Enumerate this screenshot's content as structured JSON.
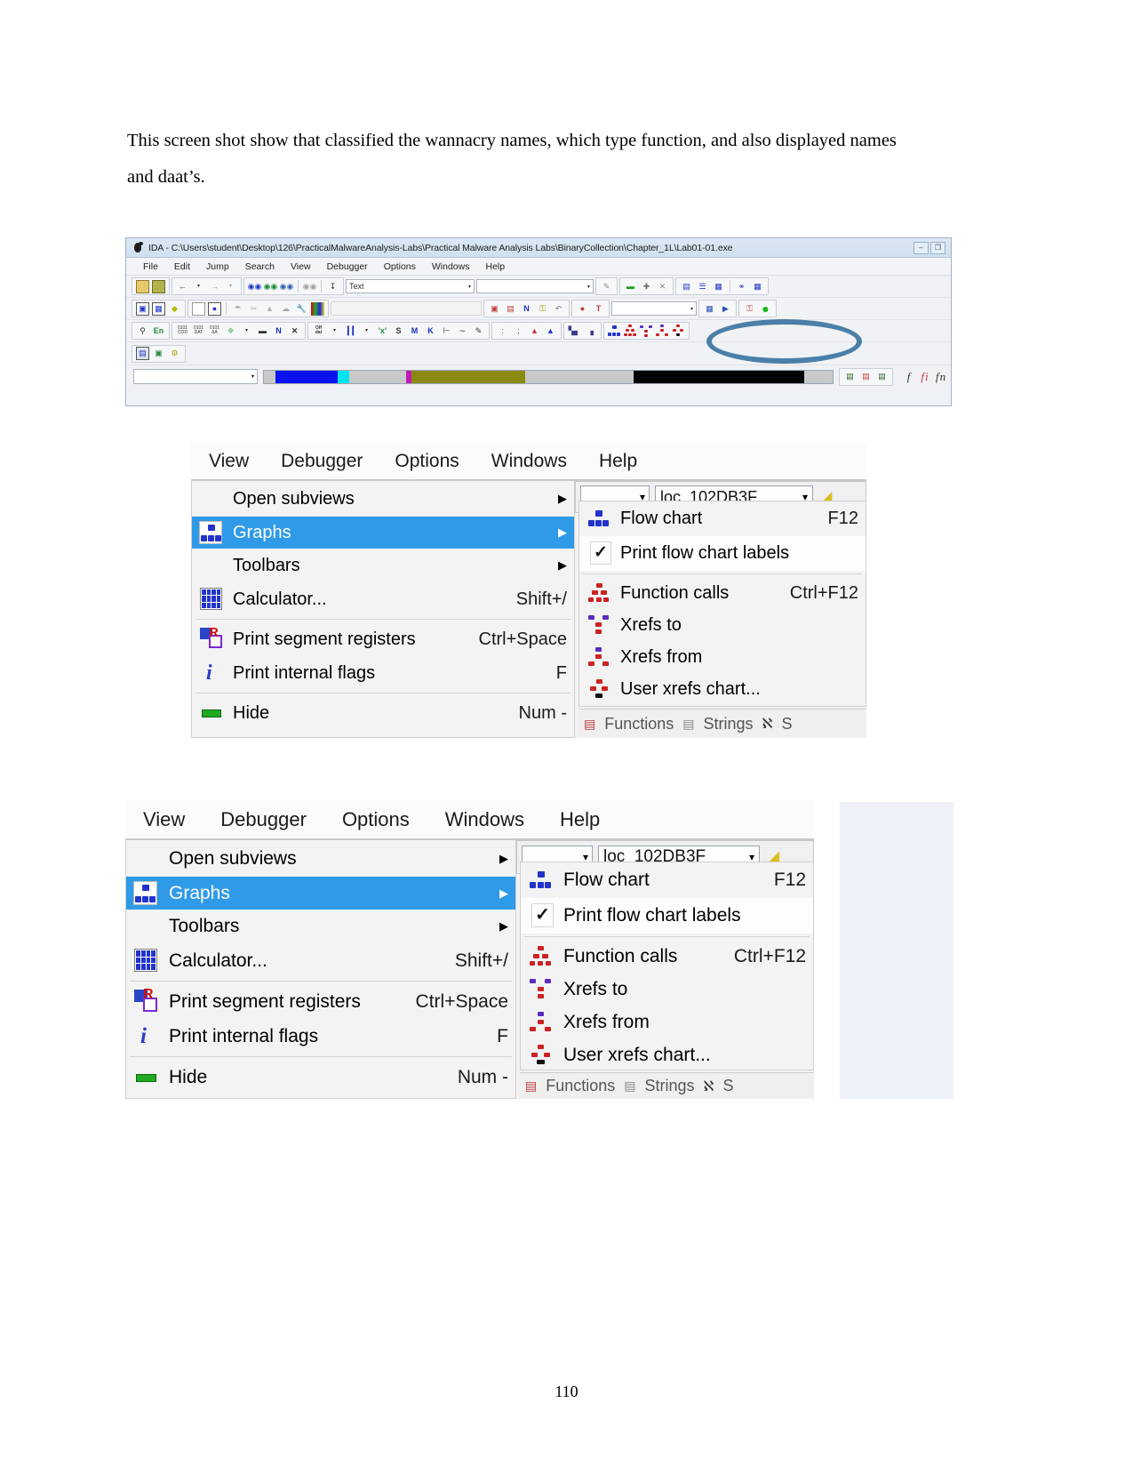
{
  "document": {
    "paragraph": "This screen shot show that classified the wannacry names, which type function, and also displayed names and daat’s.",
    "page_number": "110"
  },
  "figure_ida": {
    "title": "IDA - C:\\Users\\student\\Desktop\\126\\PracticalMalwareAnalysis-Labs\\Practical Malware Analysis Labs\\BinaryCollection\\Chapter_1L\\Lab01-01.exe",
    "window_buttons": [
      "–",
      "❐"
    ],
    "menus": [
      "File",
      "Edit",
      "Jump",
      "Search",
      "View",
      "Debugger",
      "Options",
      "Windows",
      "Help"
    ],
    "toolbar_row1": {
      "search_combo_value": "Text",
      "search_combo_arrow": "▾",
      "second_combo_value": "",
      "second_combo_arrow": "▾",
      "third_combo_value": "",
      "third_combo_arrow": "▾",
      "icons": [
        "open-folder-icon",
        "save-icon",
        "back-arrow-icon",
        "back-dropdown-icon",
        "forward-arrow-icon",
        "forward-dropdown-icon",
        "search-binoculars-blue-icon",
        "search-binoculars-green-icon",
        "search-binoculars-hex-icon",
        "search-binoculars-gray-icon",
        "jump-icon",
        "pencil-icon",
        "minus-icon",
        "plus-icon",
        "cross-icon",
        "stack-view-icon",
        "list-view-icon",
        "split-view-icon",
        "graph-overview-icon",
        "grid-icon"
      ]
    },
    "toolbar_row2": {
      "icons": [
        "structures-icon",
        "enums-icon",
        "diamond-icon",
        "page-icon",
        "image-icon",
        "trash-icon",
        "scissors-icon",
        "tree-icon",
        "cloud-icon",
        "wrench-icon",
        "palette-icon",
        "copy-icon",
        "paste-icon",
        "name-icon",
        "lock-icon",
        "green-dot-icon"
      ]
    },
    "toolbar_row3": {
      "labels": [
        "En",
        "0101 COD",
        "0101 DAT",
        "0101 ZA",
        "N",
        "X",
        "Off dat",
        "S",
        "M",
        "K"
      ],
      "icons": [
        "tower-icon",
        "code-byte-icon",
        "data-byte-icon",
        "undefine-icon",
        "array-icon",
        "name-icon",
        "delete-icon",
        "offset-icon",
        "binary-icon",
        "variable-icon",
        "stack-icon",
        "manual-icon",
        "keyword-icon",
        "comment-icon",
        "edit-icon",
        "colon-icon",
        "semicolon-icon",
        "chart-icon",
        "chart2-icon",
        "histogram-icon",
        "flow-chart-icon",
        "function-calls-icon",
        "xrefs-to-icon",
        "xrefs-from-icon",
        "user-xrefs-icon"
      ]
    },
    "toolbar_row4": {
      "icons": [
        "calculator-icon",
        "export-icon",
        "gear-icon"
      ]
    },
    "nav_combo_value": "",
    "nav_combo_arrow": "▾",
    "nav_segments": [
      {
        "color": "#c9c9c9",
        "width": 2
      },
      {
        "color": "#0a12f0",
        "width": 11
      },
      {
        "color": "#00e5f0",
        "width": 2
      },
      {
        "color": "#c9c9c9",
        "width": 10
      },
      {
        "color": "#c218b8",
        "width": 1
      },
      {
        "color": "#8a8a10",
        "width": 20
      },
      {
        "color": "#c9c9c9",
        "width": 19
      },
      {
        "color": "#000000",
        "width": 30
      },
      {
        "color": "#c9c9c9",
        "width": 5
      }
    ],
    "bottom_right_icons": [
      "windows-tile-icon",
      "windows-cascade-icon",
      "windows-close-icon",
      "font-f-icon",
      "font-fi-icon",
      "font-fn-icon"
    ],
    "annotation": {
      "shape": "ellipse",
      "color": "#4a7fa8"
    }
  },
  "menu_shot": {
    "menubar": [
      "View",
      "Debugger",
      "Options",
      "Windows",
      "Help"
    ],
    "view_items": [
      {
        "label": "Open subviews",
        "accel": "",
        "arrow": "▶",
        "icon": "",
        "selected": false
      },
      {
        "label": "Graphs",
        "accel": "",
        "arrow": "▶",
        "icon": "flow-chart-icon",
        "selected": true
      },
      {
        "label": "Toolbars",
        "accel": "",
        "arrow": "▶",
        "icon": "",
        "selected": false
      },
      {
        "label": "Calculator...",
        "accel": "Shift+/",
        "arrow": "",
        "icon": "calculator-icon",
        "selected": false
      },
      {
        "label": "Print segment registers",
        "accel": "Ctrl+Space",
        "arrow": "",
        "icon": "segment-registers-icon",
        "selected": false
      },
      {
        "label": "Print internal flags",
        "accel": "F",
        "arrow": "",
        "icon": "info-icon",
        "selected": false
      },
      {
        "label": "Hide",
        "accel": "Num -",
        "arrow": "",
        "icon": "hide-icon",
        "selected": false
      }
    ],
    "graphs_submenu": [
      {
        "label": "Flow chart",
        "accel": "F12",
        "icon": "flow-chart-icon",
        "checked": false
      },
      {
        "label": "Print flow chart labels",
        "accel": "",
        "icon": "check-icon",
        "checked": true
      },
      {
        "label": "Function calls",
        "accel": "Ctrl+F12",
        "icon": "function-calls-icon",
        "checked": false
      },
      {
        "label": "Xrefs to",
        "accel": "",
        "icon": "xrefs-to-icon",
        "checked": false
      },
      {
        "label": "Xrefs from",
        "accel": "",
        "icon": "xrefs-from-icon",
        "checked": false
      },
      {
        "label": "User xrefs chart...",
        "accel": "",
        "icon": "user-xrefs-chart-icon",
        "checked": false
      }
    ],
    "peek_toolbar": {
      "combo_empty_arrow": "▾",
      "jump_combo_value": "loc_102DB3F",
      "jump_combo_arrow": "▾"
    },
    "bottom_tabs": [
      {
        "label": "Functions",
        "icon": "functions-icon"
      },
      {
        "label": "Strings",
        "icon": "strings-icon"
      },
      {
        "label": "",
        "icon": "n-icon"
      },
      {
        "label": "S",
        "icon": ""
      }
    ]
  }
}
